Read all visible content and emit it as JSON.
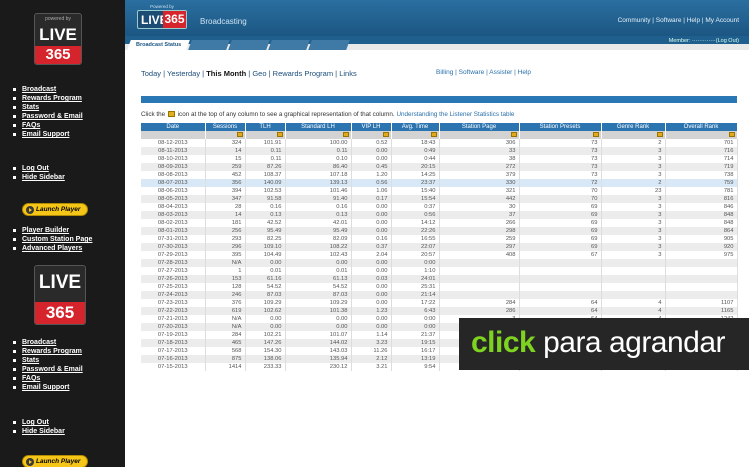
{
  "sidebar": {
    "logo_top": {
      "small": "powered by",
      "live": "LIVE",
      "num": "365"
    },
    "logo_bottom": {
      "live": "LIVE",
      "num": "365"
    },
    "group1": [
      "Broadcast",
      "Rewards Program",
      "Stats",
      "Password & Email",
      "FAQs",
      "Email Support"
    ],
    "group2": [
      "Log Out",
      "Hide Sidebar"
    ],
    "launch_label": "Launch Player",
    "group3": [
      "Player Builder",
      "Custom Station Page",
      "Advanced Players"
    ],
    "group4": [
      "Broadcast",
      "Rewards Program",
      "Stats",
      "Password & Email",
      "FAQs",
      "Email Support"
    ],
    "group5": [
      "Log Out",
      "Hide Sidebar"
    ],
    "launch_label_2": "Launch Player"
  },
  "header": {
    "logo_small": "Powered by",
    "logo_live": "LIVE",
    "logo_num": "365",
    "section": "Broadcasting",
    "links": "Community | Software | Help | My Account",
    "member": "Member: ·············(Log Out)",
    "tabs": [
      "Broadcast Status",
      "",
      "",
      "",
      ""
    ]
  },
  "content": {
    "periods": {
      "today": "Today",
      "yesterday": "Yesterday",
      "month": "This Month",
      "geo": "Geo",
      "rewards": "Rewards Program",
      "links": "Links"
    },
    "util_links": "Billing | Software | Assister | Help",
    "info_before": "Click the",
    "info_after": "icon at the top of any column to see a graphical representation of that column.",
    "info_link": "Understanding the Listener Statistics table"
  },
  "table": {
    "headers": [
      "Date",
      "Sessions",
      "TLH",
      "Standard LH",
      "VIP LH",
      "Avg. Time",
      "Station Page",
      "Station Presets",
      "Genre Rank",
      "Overall Rank"
    ],
    "rows": [
      [
        "08-12-2013",
        "324",
        "101.91",
        "100.00",
        "0.52",
        "18:43",
        "306",
        "73",
        "2",
        "701"
      ],
      [
        "08-11-2013",
        "14",
        "0.11",
        "0.11",
        "0.00",
        "0:49",
        "33",
        "73",
        "3",
        "716"
      ],
      [
        "08-10-2013",
        "15",
        "0.11",
        "0.10",
        "0.00",
        "0:44",
        "38",
        "73",
        "3",
        "714"
      ],
      [
        "08-09-2013",
        "259",
        "87.26",
        "86.40",
        "0.45",
        "20:15",
        "272",
        "73",
        "3",
        "719"
      ],
      [
        "08-08-2013",
        "452",
        "108.37",
        "107.18",
        "1.20",
        "14:25",
        "379",
        "73",
        "3",
        "738"
      ],
      [
        "08-07-2013",
        "356",
        "140.09",
        "139.13",
        "0.56",
        "23:37",
        "330",
        "72",
        "2",
        "759"
      ],
      [
        "08-06-2013",
        "394",
        "102.53",
        "101.46",
        "1.06",
        "15:40",
        "321",
        "70",
        "23",
        "781"
      ],
      [
        "08-05-2013",
        "347",
        "91.58",
        "91.40",
        "0.17",
        "15:54",
        "442",
        "70",
        "3",
        "816"
      ],
      [
        "08-04-2013",
        "28",
        "0.16",
        "0.16",
        "0.00",
        "0:37",
        "30",
        "69",
        "3",
        "846"
      ],
      [
        "08-03-2013",
        "14",
        "0.13",
        "0.13",
        "0.00",
        "0:56",
        "37",
        "69",
        "3",
        "848"
      ],
      [
        "08-02-2013",
        "181",
        "42.52",
        "42.01",
        "0.00",
        "14:12",
        "266",
        "69",
        "3",
        "848"
      ],
      [
        "08-01-2013",
        "256",
        "95.49",
        "95.49",
        "0.00",
        "22:26",
        "298",
        "69",
        "3",
        "864"
      ],
      [
        "07-31-2013",
        "293",
        "82.25",
        "82.09",
        "0.16",
        "16:55",
        "259",
        "69",
        "3",
        "905"
      ],
      [
        "07-30-2013",
        "296",
        "109.10",
        "108.22",
        "0.37",
        "22:07",
        "297",
        "69",
        "3",
        "920"
      ],
      [
        "07-29-2013",
        "395",
        "104.49",
        "102.43",
        "2.04",
        "20:57",
        "408",
        "67",
        "3",
        "975"
      ],
      [
        "07-28-2013",
        "N/A",
        "0.00",
        "0.00",
        "0.00",
        "0:00",
        "",
        "",
        "",
        ""
      ],
      [
        "07-27-2013",
        "1",
        "0.01",
        "0.01",
        "0.00",
        "1:10",
        "",
        "",
        "",
        ""
      ],
      [
        "07-26-2013",
        "153",
        "61.16",
        "61.13",
        "0.03",
        "24:01",
        "",
        "",
        "",
        ""
      ],
      [
        "07-25-2013",
        "128",
        "54.52",
        "54.52",
        "0.00",
        "25:31",
        "",
        "",
        "",
        ""
      ],
      [
        "07-24-2013",
        "246",
        "87.03",
        "87.03",
        "0.00",
        "21:14",
        "",
        "",
        "",
        ""
      ],
      [
        "07-23-2013",
        "376",
        "109.29",
        "109.29",
        "0.00",
        "17:22",
        "284",
        "64",
        "4",
        "1107"
      ],
      [
        "07-22-2013",
        "619",
        "102.62",
        "101.38",
        "1.23",
        "6:43",
        "286",
        "64",
        "4",
        "1165"
      ],
      [
        "07-21-2013",
        "N/A",
        "0.00",
        "0.00",
        "0.00",
        "0:00",
        "3",
        "64",
        "4",
        "1242"
      ],
      [
        "07-20-2013",
        "N/A",
        "0.00",
        "0.00",
        "0.00",
        "0:00",
        "10",
        "64",
        "4",
        "1226"
      ],
      [
        "07-19-2013",
        "284",
        "102.21",
        "101.07",
        "1.14",
        "21:37",
        "287",
        "64",
        "4",
        "1226"
      ],
      [
        "07-18-2013",
        "465",
        "147.26",
        "144.02",
        "3.23",
        "19:15",
        "222",
        "63",
        "4",
        "1291"
      ],
      [
        "07-17-2013",
        "568",
        "154.30",
        "143.03",
        "11.26",
        "16:17",
        "276",
        "63",
        "6",
        "1446"
      ],
      [
        "07-16-2013",
        "875",
        "138.06",
        "135.94",
        "2.12",
        "13:19",
        "346",
        "61",
        "6",
        "1643"
      ],
      [
        "07-15-2013",
        "1414",
        "233.33",
        "230.12",
        "3.21",
        "9:54",
        "677",
        "60",
        "2",
        "1675"
      ]
    ]
  },
  "overlay": {
    "click": "click",
    "rest": " para agrandar"
  },
  "colors": {
    "header_blue": "#1f5f8e",
    "table_header": "#2c74b0",
    "logo_red": "#d5242b",
    "overlay_green": "#7ed321",
    "launch_yellow": "#f5c518"
  }
}
